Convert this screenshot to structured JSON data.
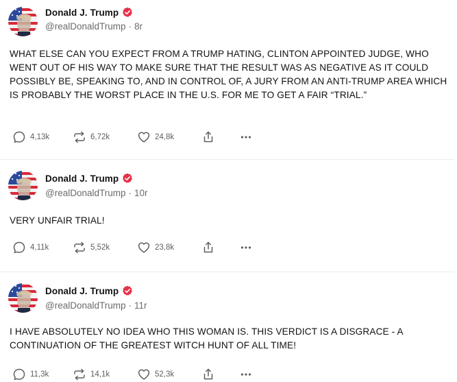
{
  "colors": {
    "name": "#111111",
    "handle": "#6b6b6b",
    "verified_badge": "#e5334b",
    "action_icon": "#5f5f5f",
    "divider": "#ececec"
  },
  "posts": [
    {
      "author_name": "Donald J. Trump",
      "handle": "@realDonaldTrump",
      "separator": "·",
      "time": "8r",
      "verified_icon": "verified-badge-icon",
      "text": "WHAT ELSE CAN YOU EXPECT FROM A TRUMP HATING, CLINTON APPOINTED JUDGE, WHO WENT OUT OF HIS WAY TO MAKE SURE THAT THE RESULT WAS AS NEGATIVE AS IT COULD POSSIBLY BE, SPEAKING TO, AND IN CONTROL OF, A JURY FROM AN ANTI-TRUMP AREA WHICH IS PROBABLY THE WORST PLACE IN THE U.S. FOR ME TO GET A FAIR “TRIAL.”",
      "replies": "4,13k",
      "retruths": "6,72k",
      "likes": "24,8k"
    },
    {
      "author_name": "Donald J. Trump",
      "handle": "@realDonaldTrump",
      "separator": "·",
      "time": "10r",
      "verified_icon": "verified-badge-icon",
      "text": "VERY UNFAIR TRIAL!",
      "replies": "4,11k",
      "retruths": "5,52k",
      "likes": "23,8k"
    },
    {
      "author_name": "Donald J. Trump",
      "handle": "@realDonaldTrump",
      "separator": "·",
      "time": "11r",
      "verified_icon": "verified-badge-icon",
      "text": "I HAVE ABSOLUTELY NO IDEA WHO THIS WOMAN IS. THIS VERDICT IS A DISGRACE - A CONTINUATION OF THE GREATEST WITCH HUNT OF ALL TIME!",
      "replies": "11,3k",
      "retruths": "14,1k",
      "likes": "52,3k"
    }
  ]
}
